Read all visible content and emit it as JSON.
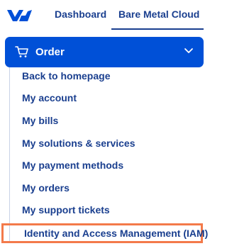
{
  "header": {
    "logo_icon": "ovhcloud-logo-icon",
    "tabs": [
      {
        "label": "Dashboard",
        "active": false
      },
      {
        "label": "Bare Metal Cloud",
        "active": true
      }
    ]
  },
  "order": {
    "label": "Order",
    "icon": "cart-icon",
    "expand_icon": "chevron-down-icon",
    "color": "#0050d7"
  },
  "menu": {
    "items": [
      {
        "label": "Back to homepage"
      },
      {
        "label": "My account"
      },
      {
        "label": "My bills"
      },
      {
        "label": "My solutions & services"
      },
      {
        "label": "My payment methods"
      },
      {
        "label": "My orders"
      },
      {
        "label": "My support tickets"
      },
      {
        "label": "Identity and Access Management (IAM)",
        "highlighted": true
      }
    ],
    "highlight_color": "#f37a4a"
  }
}
